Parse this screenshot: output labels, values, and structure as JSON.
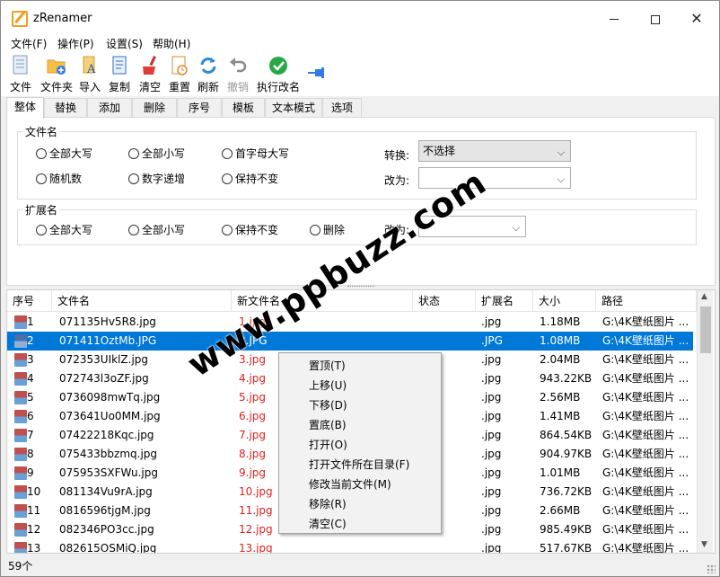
{
  "window": {
    "title": "zRenamer",
    "minimize_icon": "minimize-icon",
    "maximize_icon": "maximize-icon",
    "close_glyph": "✕"
  },
  "menu": [
    "文件(F)",
    "操作(P)",
    "设置(S)",
    "帮助(H)"
  ],
  "toolbar": [
    {
      "label": "文件",
      "icon": "file-icon"
    },
    {
      "label": "文件夹",
      "icon": "folder-add-icon"
    },
    {
      "label": "导入",
      "icon": "import-icon"
    },
    {
      "label": "复制",
      "icon": "copy-icon"
    },
    {
      "label": "清空",
      "icon": "clear-icon"
    },
    {
      "label": "重置",
      "icon": "reset-icon"
    },
    {
      "label": "刷新",
      "icon": "refresh-icon"
    },
    {
      "label": "撤销",
      "icon": "undo-icon"
    },
    {
      "label": "执行改名",
      "icon": "execute-check-icon"
    }
  ],
  "tabs": [
    "整体",
    "替换",
    "添加",
    "删除",
    "序号",
    "模板",
    "文本模式",
    "选项"
  ],
  "filename_group": {
    "title": "文件名",
    "options": [
      "全部大写",
      "全部小写",
      "首字母大写",
      "随机数",
      "数字递增",
      "保持不变"
    ],
    "convert_label": "转换:",
    "convert_value": "不选择",
    "change_label": "改为:",
    "change_value": ""
  },
  "ext_group": {
    "title": "扩展名",
    "options": [
      "全部大写",
      "全部小写",
      "保持不变",
      "删除"
    ],
    "change_label": "改为:",
    "change_value": ""
  },
  "list": {
    "headers": [
      "序号",
      "文件名",
      "新文件名",
      "状态",
      "扩展名",
      "大小",
      "路径"
    ],
    "rows": [
      {
        "no": "1",
        "name": "071135Hv5R8.jpg",
        "new": "1.jpg",
        "ext": ".jpg",
        "size": "1.18MB",
        "path": "G:\\4K壁纸图片 ..."
      },
      {
        "no": "2",
        "name": "071411OztMb.JPG",
        "new": "2.JPG",
        "ext": ".JPG",
        "size": "1.08MB",
        "path": "G:\\4K壁纸图片 ..."
      },
      {
        "no": "3",
        "name": "072353UIklZ.jpg",
        "new": "3.jpg",
        "ext": ".jpg",
        "size": "2.04MB",
        "path": "G:\\4K壁纸图片 ..."
      },
      {
        "no": "4",
        "name": "072743l3oZF.jpg",
        "new": "4.jpg",
        "ext": ".jpg",
        "size": "943.22KB",
        "path": "G:\\4K壁纸图片 ..."
      },
      {
        "no": "5",
        "name": "0736098mwTq.jpg",
        "new": "5.jpg",
        "ext": ".jpg",
        "size": "2.56MB",
        "path": "G:\\4K壁纸图片 ..."
      },
      {
        "no": "6",
        "name": "073641Uo0MM.jpg",
        "new": "6.jpg",
        "ext": ".jpg",
        "size": "1.41MB",
        "path": "G:\\4K壁纸图片 ..."
      },
      {
        "no": "7",
        "name": "07422218Kqc.jpg",
        "new": "7.jpg",
        "ext": ".jpg",
        "size": "864.54KB",
        "path": "G:\\4K壁纸图片 ..."
      },
      {
        "no": "8",
        "name": "075433bbzmq.jpg",
        "new": "8.jpg",
        "ext": ".jpg",
        "size": "904.97KB",
        "path": "G:\\4K壁纸图片 ..."
      },
      {
        "no": "9",
        "name": "075953SXFWu.jpg",
        "new": "9.jpg",
        "ext": ".jpg",
        "size": "1.01MB",
        "path": "G:\\4K壁纸图片 ..."
      },
      {
        "no": "10",
        "name": "081134Vu9rA.jpg",
        "new": "10.jpg",
        "ext": ".jpg",
        "size": "736.72KB",
        "path": "G:\\4K壁纸图片 ..."
      },
      {
        "no": "11",
        "name": "0816596tjgM.jpg",
        "new": "11.jpg",
        "ext": ".jpg",
        "size": "2.66MB",
        "path": "G:\\4K壁纸图片 ..."
      },
      {
        "no": "12",
        "name": "082346PO3cc.jpg",
        "new": "12.jpg",
        "ext": ".jpg",
        "size": "985.49KB",
        "path": "G:\\4K壁纸图片 ..."
      },
      {
        "no": "13",
        "name": "082615OSMiQ.jpg",
        "new": "13.jpg",
        "ext": ".jpg",
        "size": "517.67KB",
        "path": "G:\\4K壁纸图片 ..."
      }
    ]
  },
  "context_menu": [
    "置顶(T)",
    "上移(U)",
    "下移(D)",
    "置底(B)",
    "打开(O)",
    "打开文件所在目录(F)",
    "修改当前文件(M)",
    "移除(R)",
    "清空(C)"
  ],
  "status": {
    "count": "59个"
  },
  "watermark": "www.ppbuzz.com"
}
